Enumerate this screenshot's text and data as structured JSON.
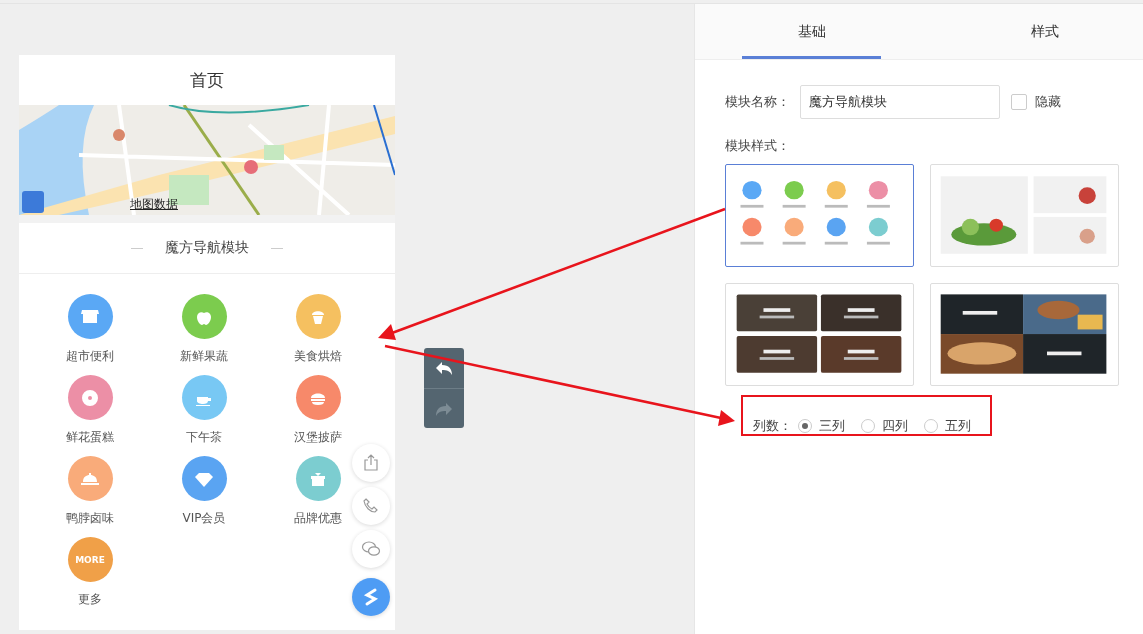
{
  "preview": {
    "title": "首页",
    "map_link": "地图数据",
    "module_title": "魔方导航模块",
    "nav_items": [
      {
        "label": "超市便利",
        "color": "#5aa8f5"
      },
      {
        "label": "新鲜果蔬",
        "color": "#7ccc4e"
      },
      {
        "label": "美食烘焙",
        "color": "#f5c060"
      },
      {
        "label": "鲜花蛋糕",
        "color": "#ec8fa6"
      },
      {
        "label": "下午茶",
        "color": "#78c8f4"
      },
      {
        "label": "汉堡披萨",
        "color": "#f7896a"
      },
      {
        "label": "鸭脖卤味",
        "color": "#f9ab7a"
      },
      {
        "label": "VIP会员",
        "color": "#5aa4f2"
      },
      {
        "label": "品牌优惠",
        "color": "#7ccdd0"
      },
      {
        "label": "更多",
        "color": "#f0a048",
        "badge": "MORE"
      }
    ]
  },
  "history": [
    {
      "kind": "undo",
      "disabled": false
    },
    {
      "kind": "redo",
      "disabled": true
    }
  ],
  "panel": {
    "tabs": [
      {
        "label": "基础",
        "selected": true
      },
      {
        "label": "样式",
        "selected": false
      }
    ],
    "name_field": {
      "label": "模块名称：",
      "value": "魔方导航模块"
    },
    "hide_toggle": {
      "label": "隐藏",
      "checked": false
    },
    "style_label": "模块样式：",
    "styles": [
      {
        "kind": "icon-grid",
        "selected": true
      },
      {
        "kind": "feature-list",
        "selected": false
      },
      {
        "kind": "tiles",
        "selected": false
      },
      {
        "kind": "checker",
        "selected": false
      }
    ],
    "columns": {
      "label": "列数：",
      "options": [
        {
          "label": "三列",
          "selected": true
        },
        {
          "label": "四列",
          "selected": false
        },
        {
          "label": "五列",
          "selected": false
        }
      ]
    }
  }
}
